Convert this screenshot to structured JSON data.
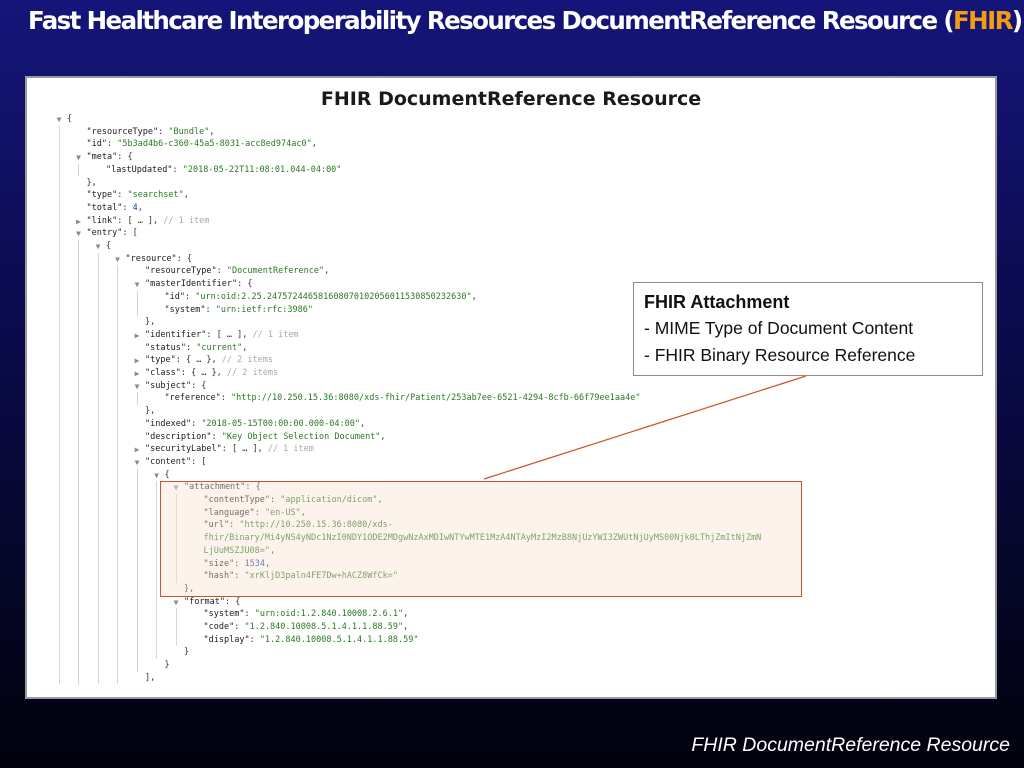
{
  "slide": {
    "title_main": "Fast Healthcare Interoperability Resources DocumentReference Resource (",
    "title_accent": "FHIR",
    "title_close": ")",
    "accent_color": "#f39c12",
    "footer": "FHIR DocumentReference Resource"
  },
  "panel": {
    "title": "FHIR DocumentReference Resource"
  },
  "callout": {
    "title": "FHIR Attachment",
    "items": [
      "- MIME Type of Document Content",
      "- FHIR Binary Resource Reference"
    ],
    "connector_color": "#c9562a"
  },
  "json_viewer": {
    "lines": [
      {
        "depth": 0,
        "twisty": "expanded",
        "parts": [
          [
            "p",
            "{"
          ]
        ]
      },
      {
        "depth": 1,
        "parts": [
          [
            "k",
            "\"resourceType\""
          ],
          [
            "p",
            ": "
          ],
          [
            "s",
            "\"Bundle\""
          ],
          [
            "p",
            ","
          ]
        ]
      },
      {
        "depth": 1,
        "parts": [
          [
            "k",
            "\"id\""
          ],
          [
            "p",
            ": "
          ],
          [
            "s",
            "\"5b3ad4b6-c360-45a5-8031-acc8ed974ac0\""
          ],
          [
            "p",
            ","
          ]
        ]
      },
      {
        "depth": 1,
        "twisty": "expanded",
        "parts": [
          [
            "k",
            "\"meta\""
          ],
          [
            "p",
            ": {"
          ]
        ]
      },
      {
        "depth": 2,
        "parts": [
          [
            "k",
            "\"lastUpdated\""
          ],
          [
            "p",
            ": "
          ],
          [
            "s",
            "\"2018-05-22T11:08:01.044-04:00\""
          ]
        ]
      },
      {
        "depth": 1,
        "parts": [
          [
            "p",
            "},"
          ]
        ]
      },
      {
        "depth": 1,
        "parts": [
          [
            "k",
            "\"type\""
          ],
          [
            "p",
            ": "
          ],
          [
            "s",
            "\"searchset\""
          ],
          [
            "p",
            ","
          ]
        ]
      },
      {
        "depth": 1,
        "parts": [
          [
            "k",
            "\"total\""
          ],
          [
            "p",
            ": "
          ],
          [
            "n",
            "4"
          ],
          [
            "p",
            ","
          ]
        ]
      },
      {
        "depth": 1,
        "twisty": "collapsed",
        "parts": [
          [
            "k",
            "\"link\""
          ],
          [
            "p",
            ": [ … ], "
          ],
          [
            "c",
            "// 1 item"
          ]
        ]
      },
      {
        "depth": 1,
        "twisty": "expanded",
        "parts": [
          [
            "k",
            "\"entry\""
          ],
          [
            "p",
            ": ["
          ]
        ]
      },
      {
        "depth": 2,
        "twisty": "expanded",
        "parts": [
          [
            "p",
            "{"
          ]
        ]
      },
      {
        "depth": 3,
        "twisty": "expanded",
        "parts": [
          [
            "k",
            "\"resource\""
          ],
          [
            "p",
            ": {"
          ]
        ]
      },
      {
        "depth": 4,
        "parts": [
          [
            "k",
            "\"resourceType\""
          ],
          [
            "p",
            ": "
          ],
          [
            "s",
            "\"DocumentReference\""
          ],
          [
            "p",
            ","
          ]
        ]
      },
      {
        "depth": 4,
        "twisty": "expanded",
        "parts": [
          [
            "k",
            "\"masterIdentifier\""
          ],
          [
            "p",
            ": {"
          ]
        ]
      },
      {
        "depth": 5,
        "parts": [
          [
            "k",
            "\"id\""
          ],
          [
            "p",
            ": "
          ],
          [
            "s",
            "\"urn:oid:2.25.247572446581608070102056011530850232630\""
          ],
          [
            "p",
            ","
          ]
        ]
      },
      {
        "depth": 5,
        "parts": [
          [
            "k",
            "\"system\""
          ],
          [
            "p",
            ": "
          ],
          [
            "s",
            "\"urn:ietf:rfc:3986\""
          ]
        ]
      },
      {
        "depth": 4,
        "parts": [
          [
            "p",
            "},"
          ]
        ]
      },
      {
        "depth": 4,
        "twisty": "collapsed",
        "parts": [
          [
            "k",
            "\"identifier\""
          ],
          [
            "p",
            ": [ … ], "
          ],
          [
            "c",
            "// 1 item"
          ]
        ]
      },
      {
        "depth": 4,
        "parts": [
          [
            "k",
            "\"status\""
          ],
          [
            "p",
            ": "
          ],
          [
            "s",
            "\"current\""
          ],
          [
            "p",
            ","
          ]
        ]
      },
      {
        "depth": 4,
        "twisty": "collapsed",
        "parts": [
          [
            "k",
            "\"type\""
          ],
          [
            "p",
            ": { … }, "
          ],
          [
            "c",
            "// 2 items"
          ]
        ]
      },
      {
        "depth": 4,
        "twisty": "collapsed",
        "parts": [
          [
            "k",
            "\"class\""
          ],
          [
            "p",
            ": { … }, "
          ],
          [
            "c",
            "// 2 items"
          ]
        ]
      },
      {
        "depth": 4,
        "twisty": "expanded",
        "parts": [
          [
            "k",
            "\"subject\""
          ],
          [
            "p",
            ": {"
          ]
        ]
      },
      {
        "depth": 5,
        "parts": [
          [
            "k",
            "\"reference\""
          ],
          [
            "p",
            ": "
          ],
          [
            "s",
            "\"http://10.250.15.36:8080/xds-fhir/Patient/253ab7ee-6521-4294-8cfb-66f79ee1aa4e\""
          ]
        ]
      },
      {
        "depth": 4,
        "parts": [
          [
            "p",
            "},"
          ]
        ]
      },
      {
        "depth": 4,
        "parts": [
          [
            "k",
            "\"indexed\""
          ],
          [
            "p",
            ": "
          ],
          [
            "s",
            "\"2018-05-15T00:00:00.000-04:00\""
          ],
          [
            "p",
            ","
          ]
        ]
      },
      {
        "depth": 4,
        "parts": [
          [
            "k",
            "\"description\""
          ],
          [
            "p",
            ": "
          ],
          [
            "s",
            "\"Key Object Selection Document\""
          ],
          [
            "p",
            ","
          ]
        ]
      },
      {
        "depth": 4,
        "twisty": "collapsed",
        "parts": [
          [
            "k",
            "\"securityLabel\""
          ],
          [
            "p",
            ": [ … ], "
          ],
          [
            "c",
            "// 1 item"
          ]
        ]
      },
      {
        "depth": 4,
        "twisty": "expanded",
        "parts": [
          [
            "k",
            "\"content\""
          ],
          [
            "p",
            ": ["
          ]
        ]
      },
      {
        "depth": 5,
        "twisty": "expanded",
        "parts": [
          [
            "p",
            "{"
          ]
        ]
      },
      {
        "depth": 6,
        "twisty": "expanded",
        "parts": [
          [
            "k",
            "\"attachment\""
          ],
          [
            "p",
            ": {"
          ]
        ]
      },
      {
        "depth": 7,
        "parts": [
          [
            "k",
            "\"contentType\""
          ],
          [
            "p",
            ": "
          ],
          [
            "s",
            "\"application/dicom\""
          ],
          [
            "p",
            ","
          ]
        ]
      },
      {
        "depth": 7,
        "parts": [
          [
            "k",
            "\"language\""
          ],
          [
            "p",
            ": "
          ],
          [
            "s",
            "\"en-US\""
          ],
          [
            "p",
            ","
          ]
        ]
      },
      {
        "depth": 7,
        "parts": [
          [
            "k",
            "\"url\""
          ],
          [
            "p",
            ": "
          ],
          [
            "s",
            "\"http://10.250.15.36:8080/xds-"
          ]
        ]
      },
      {
        "depth": 7,
        "parts": [
          [
            "s",
            "fhir/Binary/Mi4yNS4yNDc1NzI0NDY1ODE2MDgwNzAxMDIwNTYwMTE1MzA4NTAyMzI2MzB8NjUzYWI3ZWUtNjUyMS00Njk0LThjZmItNjZmN"
          ]
        ]
      },
      {
        "depth": 7,
        "parts": [
          [
            "s",
            "LjUuMSZJU08=\""
          ],
          [
            "p",
            ","
          ]
        ]
      },
      {
        "depth": 7,
        "parts": [
          [
            "k",
            "\"size\""
          ],
          [
            "p",
            ": "
          ],
          [
            "n",
            "1534"
          ],
          [
            "p",
            ","
          ]
        ]
      },
      {
        "depth": 7,
        "parts": [
          [
            "k",
            "\"hash\""
          ],
          [
            "p",
            ": "
          ],
          [
            "s",
            "\"xrKljD3paln4FE7Dw+hACZ8WfCk=\""
          ]
        ]
      },
      {
        "depth": 6,
        "parts": [
          [
            "p",
            "},"
          ]
        ]
      },
      {
        "depth": 6,
        "twisty": "expanded",
        "parts": [
          [
            "k",
            "\"format\""
          ],
          [
            "p",
            ": {"
          ]
        ]
      },
      {
        "depth": 7,
        "parts": [
          [
            "k",
            "\"system\""
          ],
          [
            "p",
            ": "
          ],
          [
            "s",
            "\"urn:oid:1.2.840.10008.2.6.1\""
          ],
          [
            "p",
            ","
          ]
        ]
      },
      {
        "depth": 7,
        "parts": [
          [
            "k",
            "\"code\""
          ],
          [
            "p",
            ": "
          ],
          [
            "s",
            "\"1.2.840.10008.5.1.4.1.1.88.59\""
          ],
          [
            "p",
            ","
          ]
        ]
      },
      {
        "depth": 7,
        "parts": [
          [
            "k",
            "\"display\""
          ],
          [
            "p",
            ": "
          ],
          [
            "s",
            "\"1.2.840.10008.5.1.4.1.1.88.59\""
          ]
        ]
      },
      {
        "depth": 6,
        "parts": [
          [
            "p",
            "}"
          ]
        ]
      },
      {
        "depth": 5,
        "parts": [
          [
            "p",
            "}"
          ]
        ]
      },
      {
        "depth": 4,
        "parts": [
          [
            "p",
            "],"
          ]
        ]
      }
    ]
  }
}
